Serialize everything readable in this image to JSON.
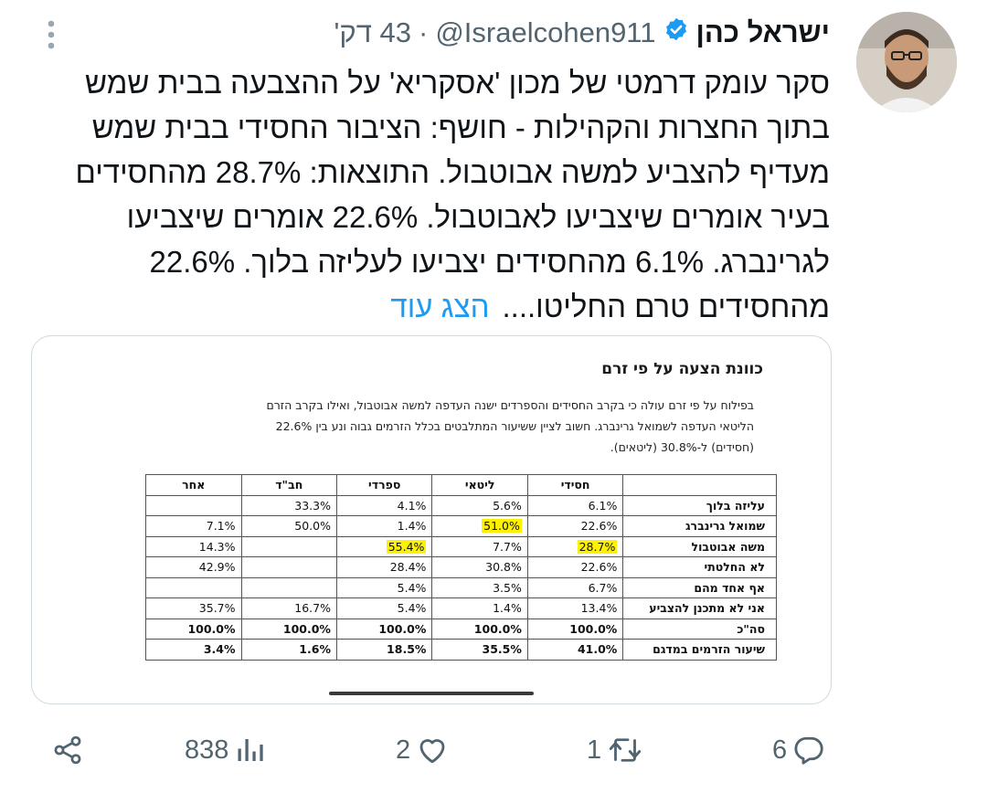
{
  "tweet": {
    "author_name": "ישראל כהן",
    "verified": true,
    "handle": "@Israelcohen911",
    "separator": "·",
    "time": "43 דק'",
    "text_lines": [
      "סקר עומק דרמטי של מכון 'אסקריא' על ההצבעה בבית שמש",
      "בתוך החצרות והקהילות - חושף: הציבור החסידי בבית שמש",
      "מעדיף להצביע למשה אבוטבול. התוצאות: 28.7% מהחסידים",
      "בעיר אומרים שיצביעו לאבוטבול. 22.6% אומרים שיצביעו",
      "לגרינברג. 6.1% מהחסידים יצביעו לעליזה בלוך. 22.6%",
      "מהחסידים טרם החליטו...."
    ],
    "show_more": "הצג עוד"
  },
  "image": {
    "title": "כוונת  הצעה על פי זרם",
    "paragraph_lines": [
      "בפילוח על פי זרם עולה כי בקרב החסידים והספרדים ישנה העדפה למשה אבוטבול, ואילו בקרב הזרם",
      "הליטאי העדפה לשמואל גרינברג. חשוב לציין ששיעור המתלבטים בכלל הזרמים גבוה ונע בין 22.6%",
      "(חסידים) ל-30.8% (ליטאים)."
    ],
    "table": {
      "headers": [
        "",
        "חסידי",
        "ליטאי",
        "ספרדי",
        "חב\"ד",
        "אחר"
      ],
      "rows": [
        {
          "label": "עליזה בלוך",
          "cells": [
            "6.1%",
            "5.6%",
            "4.1%",
            "33.3%",
            ""
          ]
        },
        {
          "label": "שמואל גרינברג",
          "cells": [
            "22.6%",
            "51.0%",
            "1.4%",
            "50.0%",
            "7.1%"
          ]
        },
        {
          "label": "משה אבוטבול",
          "cells": [
            "28.7%",
            "7.7%",
            "55.4%",
            "",
            "14.3%"
          ]
        },
        {
          "label": "לא החלטתי",
          "cells": [
            "22.6%",
            "30.8%",
            "28.4%",
            "",
            "42.9%"
          ]
        },
        {
          "label": "אף אחד מהם",
          "cells": [
            "6.7%",
            "3.5%",
            "5.4%",
            "",
            ""
          ]
        },
        {
          "label": "אני לא מתכנן להצביע",
          "cells": [
            "13.4%",
            "1.4%",
            "5.4%",
            "16.7%",
            "35.7%"
          ]
        },
        {
          "label": "סה\"כ",
          "cells": [
            "100.0%",
            "100.0%",
            "100.0%",
            "100.0%",
            "100.0%"
          ]
        },
        {
          "label": "שיעור הזרמים במדגם",
          "cells": [
            "41.0%",
            "35.5%",
            "18.5%",
            "1.6%",
            "3.4%"
          ]
        }
      ],
      "highlighted_cells": [
        "51.0%",
        "55.4%",
        "28.7%"
      ],
      "highlight_color": "#fff200"
    }
  },
  "actions": {
    "replies": "6",
    "retweets": "1",
    "likes": "2",
    "views": "838"
  },
  "colors": {
    "accent": "#1d9bf0",
    "muted": "#536471",
    "text": "#0f1419"
  },
  "icons": [
    "more-icon",
    "verified-badge-icon",
    "reply-icon",
    "retweet-icon",
    "like-icon",
    "views-icon",
    "share-icon"
  ]
}
